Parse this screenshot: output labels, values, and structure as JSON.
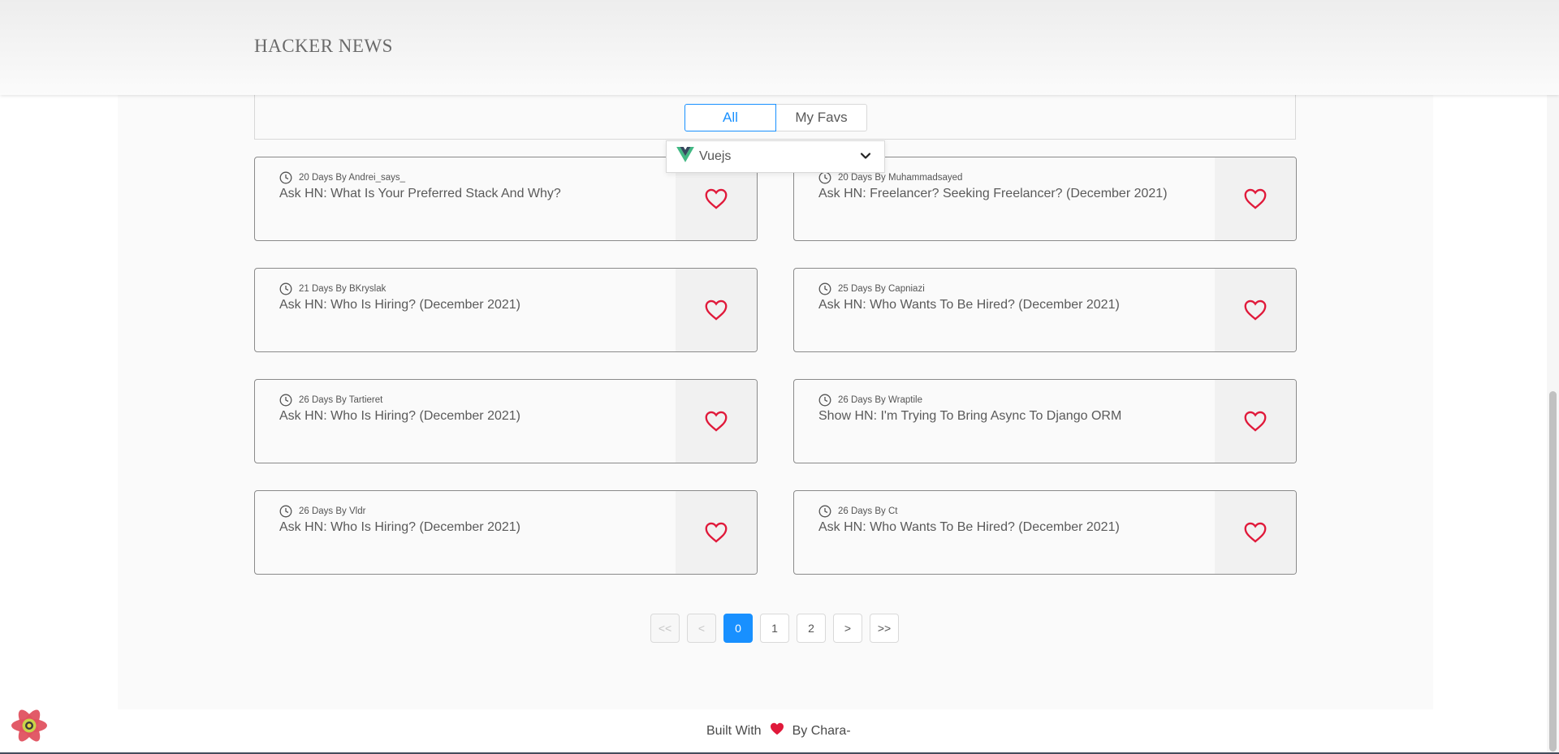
{
  "header": {
    "brand": "HACKER NEWS"
  },
  "filter": {
    "tabs": [
      {
        "label": "All",
        "active": true
      },
      {
        "label": "My Favs",
        "active": false
      }
    ],
    "framework_select": {
      "selected": "Vuejs",
      "icon": "vue-logo-icon"
    }
  },
  "posts": [
    {
      "meta": "20 Days By Andrei_says_",
      "title": "Ask HN: What Is Your Preferred Stack And Why?"
    },
    {
      "meta": "20 Days By Muhammadsayed",
      "title": "Ask HN: Freelancer? Seeking Freelancer? (December 2021)"
    },
    {
      "meta": "21 Days By BKryslak",
      "title": "Ask HN: Who Is Hiring? (December 2021)"
    },
    {
      "meta": "25 Days By Capniazi",
      "title": "Ask HN: Who Wants To Be Hired? (December 2021)"
    },
    {
      "meta": "26 Days By Tartieret",
      "title": "Ask HN: Who Is Hiring? (December 2021)"
    },
    {
      "meta": "26 Days By Wraptile",
      "title": "Show HN: I'm Trying To Bring Async To Django ORM"
    },
    {
      "meta": "26 Days By Vldr",
      "title": "Ask HN: Who Is Hiring? (December 2021)"
    },
    {
      "meta": "26 Days By Ct",
      "title": "Ask HN: Who Wants To Be Hired? (December 2021)"
    }
  ],
  "pagination": {
    "first": "<<",
    "prev": "<",
    "pages": [
      "0",
      "1",
      "2"
    ],
    "current": "0",
    "next": ">",
    "last": ">>"
  },
  "footer": {
    "prefix": "Built With",
    "suffix": "By Chara-"
  },
  "colors": {
    "accent": "#1890ff",
    "heart": "#e0193a",
    "vue_green": "#41b883",
    "vue_dark": "#35495e"
  }
}
